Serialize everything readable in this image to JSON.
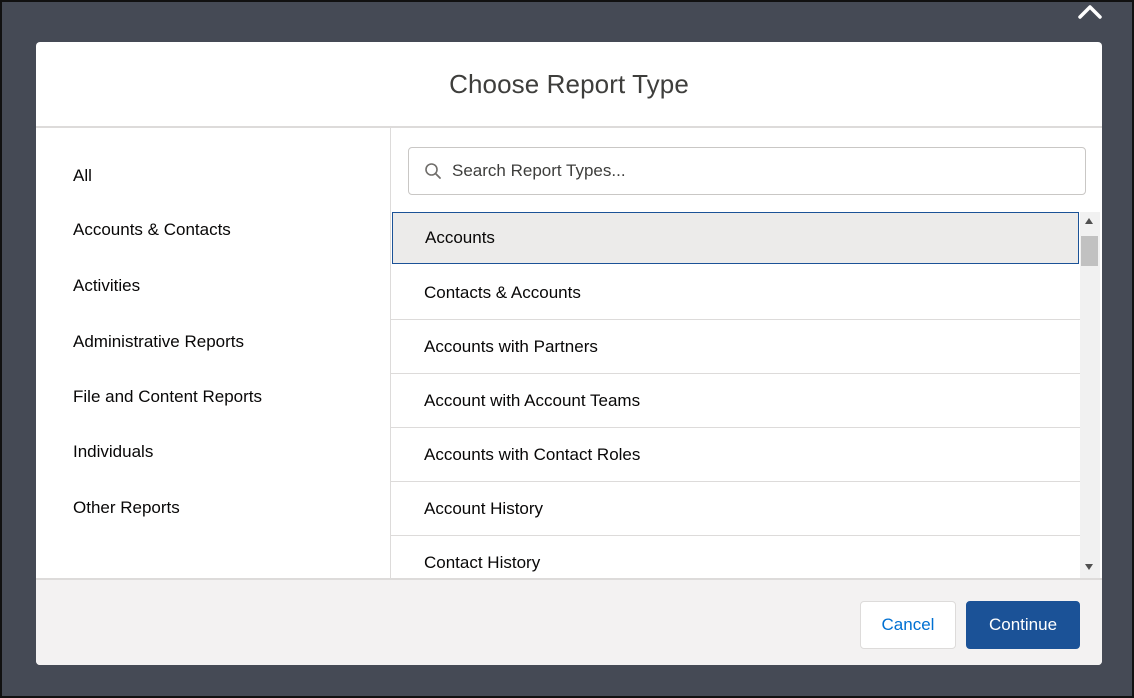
{
  "modal": {
    "title": "Choose Report Type"
  },
  "close_icon": "close-chevron",
  "sidebar": {
    "items": [
      {
        "label": "All"
      },
      {
        "label": "Accounts & Contacts"
      },
      {
        "label": "Activities"
      },
      {
        "label": "Administrative Reports"
      },
      {
        "label": "File and Content Reports"
      },
      {
        "label": "Individuals"
      },
      {
        "label": "Other Reports"
      }
    ]
  },
  "search": {
    "placeholder": "Search Report Types...",
    "value": ""
  },
  "report_types": [
    {
      "label": "Accounts",
      "selected": true
    },
    {
      "label": "Contacts & Accounts"
    },
    {
      "label": "Accounts with Partners"
    },
    {
      "label": "Account with Account Teams"
    },
    {
      "label": "Accounts with Contact Roles"
    },
    {
      "label": "Account History"
    },
    {
      "label": "Contact History"
    }
  ],
  "footer": {
    "cancel_label": "Cancel",
    "continue_label": "Continue"
  },
  "colors": {
    "backdrop": "#454a55",
    "accent": "#1b5297",
    "link": "#0070d2",
    "selected_row": "#ecebea"
  }
}
